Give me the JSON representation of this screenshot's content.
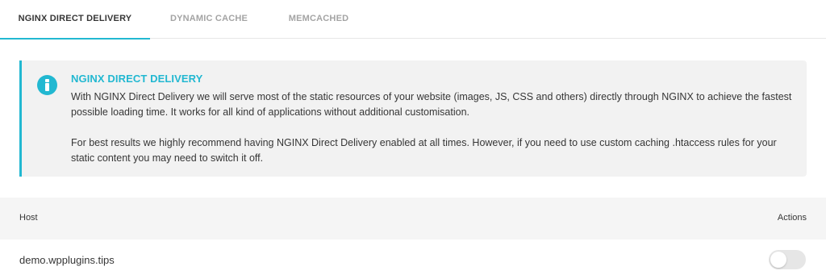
{
  "tabs": [
    {
      "label": "NGINX DIRECT DELIVERY",
      "active": true
    },
    {
      "label": "DYNAMIC CACHE",
      "active": false
    },
    {
      "label": "MEMCACHED",
      "active": false
    }
  ],
  "notice": {
    "icon": "info-icon",
    "title": "NGINX DIRECT DELIVERY",
    "paragraph_1": "With NGINX Direct Delivery we will serve most of the static resources of your website (images, JS, CSS and others) directly through NGINX to achieve the fastest possible loading time. It works for all kind of applications without additional customisation.",
    "paragraph_2": "For best results we highly recommend having NGINX Direct Delivery enabled at all times. However, if you need to use custom caching .htaccess rules for your static content you may need to switch it off."
  },
  "table": {
    "headers": {
      "host": "Host",
      "actions": "Actions"
    },
    "rows": [
      {
        "host": "demo.wpplugins.tips",
        "enabled": false
      }
    ]
  },
  "colors": {
    "accent": "#22b8d1",
    "notice_bg": "#f2f2f2",
    "toggle_off": "#e6e6e6"
  }
}
